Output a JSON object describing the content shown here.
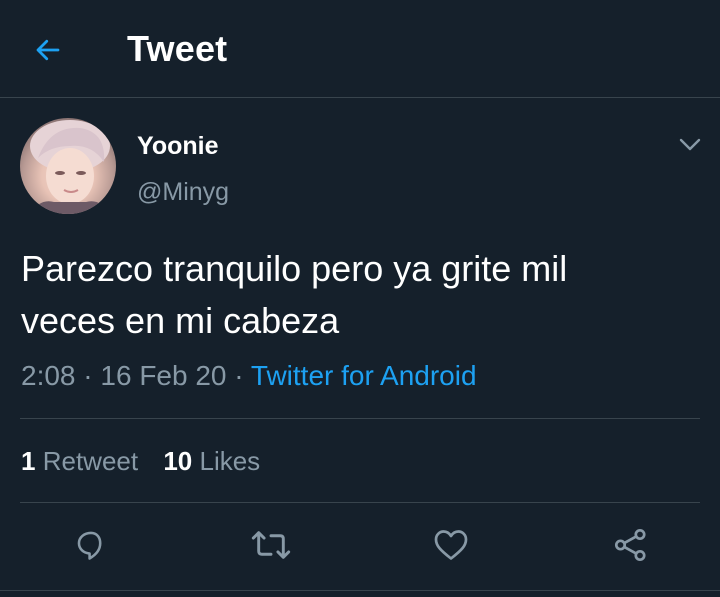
{
  "header": {
    "title": "Tweet",
    "back_icon": "arrow-left-icon"
  },
  "user": {
    "display_name": "Yoonie",
    "handle": "@Minyg"
  },
  "tweet": {
    "text_line1": "Parezco tranquilo pero ya grite mil",
    "text_line2": "veces en mi cabeza",
    "time": "2:08",
    "separator": "·",
    "date": "16 Feb 20",
    "source": "Twitter for Android"
  },
  "stats": {
    "retweets_count": "1",
    "retweets_label": "Retweet",
    "likes_count": "10",
    "likes_label": "Likes"
  },
  "actions": [
    "reply-icon",
    "retweet-icon",
    "like-icon",
    "share-icon"
  ],
  "colors": {
    "background": "#15202b",
    "accent": "#1da1f2",
    "secondary_text": "#8899a6",
    "divider": "#38444d"
  }
}
